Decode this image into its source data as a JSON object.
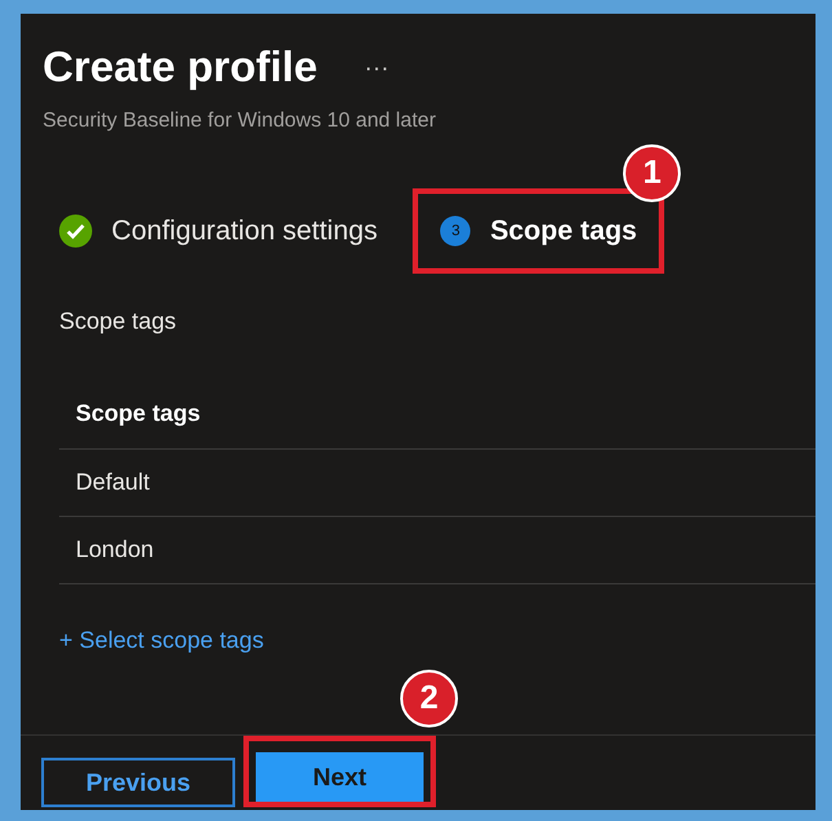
{
  "title": "Create profile",
  "more": "···",
  "subtitle": "Security Baseline for Windows 10 and later",
  "steps": [
    {
      "label": "Configuration settings",
      "completed": true,
      "highlighted": false
    },
    {
      "label": "Scope tags",
      "completed": false,
      "number": "3",
      "highlighted": true,
      "callout": "1"
    }
  ],
  "section_label": "Scope tags",
  "table": {
    "columns": [
      "Scope tags"
    ],
    "rows": [
      [
        "Default"
      ],
      [
        "London"
      ]
    ]
  },
  "link": "+ Select scope tags",
  "buttons": [
    {
      "label": "Previous",
      "kind": "secondary",
      "highlighted": false
    },
    {
      "label": "Next",
      "kind": "primary",
      "highlighted": true,
      "callout": "2"
    }
  ]
}
